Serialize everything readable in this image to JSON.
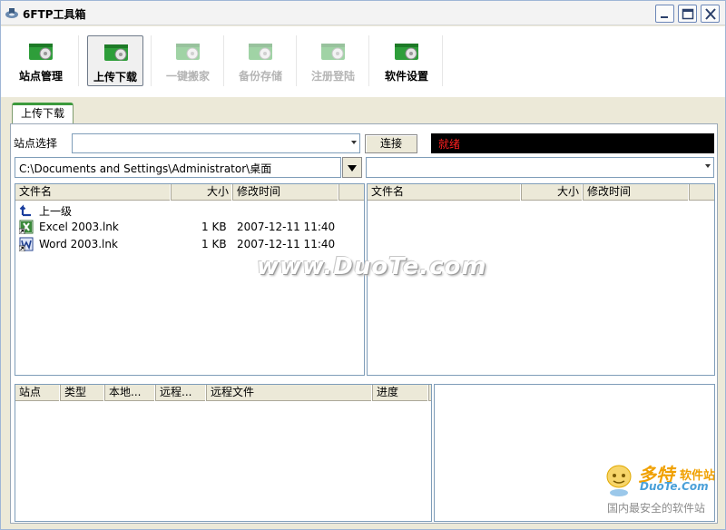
{
  "window": {
    "title": "6FTP工具箱"
  },
  "toolbar": {
    "items": [
      {
        "label": "站点管理",
        "state": "normal"
      },
      {
        "label": "上传下载",
        "state": "active"
      },
      {
        "label": "一键搬家",
        "state": "disabled"
      },
      {
        "label": "备份存储",
        "state": "disabled"
      },
      {
        "label": "注册登陆",
        "state": "disabled"
      },
      {
        "label": "软件设置",
        "state": "normal"
      }
    ]
  },
  "tabs": [
    {
      "label": "上传下载",
      "selected": true
    }
  ],
  "site": {
    "label": "站点选择",
    "value": "",
    "connect_label": "连接",
    "status": "就绪"
  },
  "local": {
    "path": "C:\\Documents and Settings\\Administrator\\桌面",
    "columns": [
      "文件名",
      "大小",
      "修改时间"
    ],
    "rows": [
      {
        "name": "上一级",
        "size": "",
        "mtime": "",
        "icon": "up-folder-icon"
      },
      {
        "name": "Excel 2003.lnk",
        "size": "1 KB",
        "mtime": "2007-12-11 11:40",
        "icon": "excel-icon"
      },
      {
        "name": "Word 2003.lnk",
        "size": "1 KB",
        "mtime": "2007-12-11 11:40",
        "icon": "word-icon"
      }
    ]
  },
  "remote": {
    "path": "",
    "columns": [
      "文件名",
      "大小",
      "修改时间"
    ]
  },
  "queue": {
    "columns": [
      "站点",
      "类型",
      "本地...",
      "远程...",
      "远程文件",
      "进度"
    ]
  },
  "watermark": {
    "text": "www.DuoTe.com"
  },
  "logo": {
    "brand": "多特",
    "brand_suffix": "软件站",
    "site": "DuoTe.Com",
    "slogan": "国内最安全的软件站"
  },
  "colors": {
    "accent_green": "#3c9a3c",
    "status_bg": "#000000",
    "status_text": "#ff2020"
  }
}
